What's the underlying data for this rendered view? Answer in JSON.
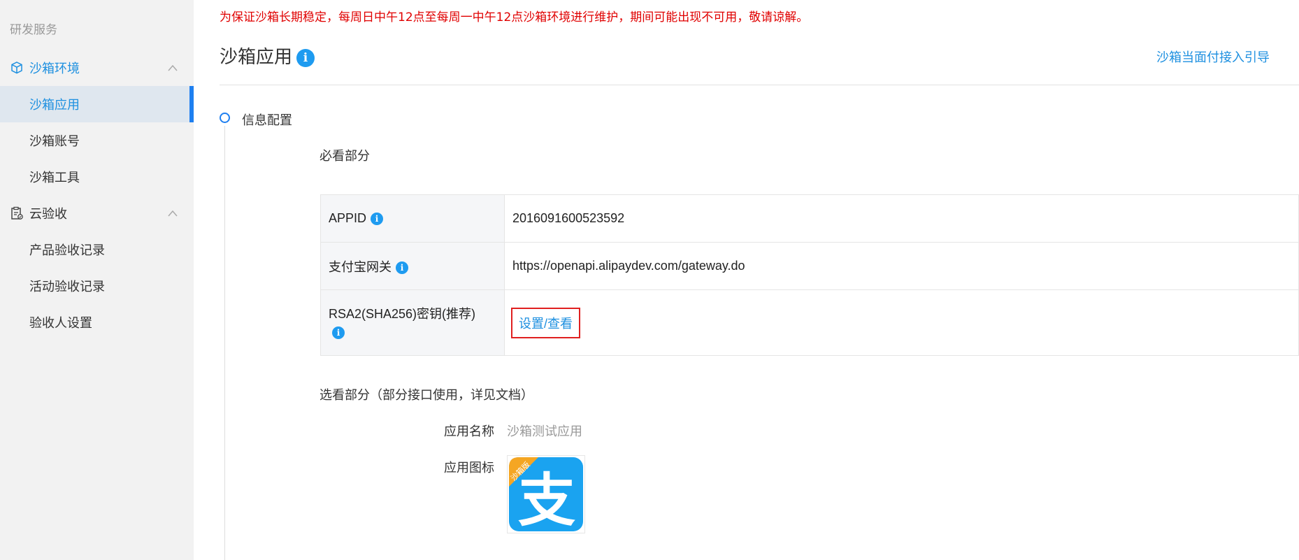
{
  "sidebar": {
    "section_title": "研发服务",
    "groups": [
      {
        "label": "沙箱环境",
        "icon": "cube-icon",
        "items": [
          {
            "label": "沙箱应用"
          },
          {
            "label": "沙箱账号"
          },
          {
            "label": "沙箱工具"
          }
        ]
      },
      {
        "label": "云验收",
        "icon": "clipboard-icon",
        "items": [
          {
            "label": "产品验收记录"
          },
          {
            "label": "活动验收记录"
          },
          {
            "label": "验收人设置"
          }
        ]
      }
    ]
  },
  "notice": "为保证沙箱长期稳定，每周日中午12点至每周一中午12点沙箱环境进行维护，期间可能出现不可用，敬请谅解。",
  "header": {
    "title": "沙箱应用",
    "info_glyph": "i",
    "guide_link": "沙箱当面付接入引导"
  },
  "step": {
    "title": "信息配置"
  },
  "required": {
    "title": "必看部分",
    "rows": [
      {
        "key": "APPID",
        "value": "2016091600523592"
      },
      {
        "key": "支付宝网关",
        "value": "https://openapi.alipaydev.com/gateway.do"
      },
      {
        "key": "RSA2(SHA256)密钥(推荐)",
        "value": "设置/查看"
      }
    ]
  },
  "optional": {
    "title": "选看部分（部分接口使用，详见文档）",
    "app_name_label": "应用名称",
    "app_name_value": "沙箱测试应用",
    "app_icon_label": "应用图标",
    "app_icon_badge": "沙箱版",
    "app_icon_glyph": "支"
  },
  "colors": {
    "accent": "#1e90e0",
    "notice": "#e00000",
    "alipay_blue": "#1aa3f0",
    "badge_orange": "#f5a623"
  }
}
